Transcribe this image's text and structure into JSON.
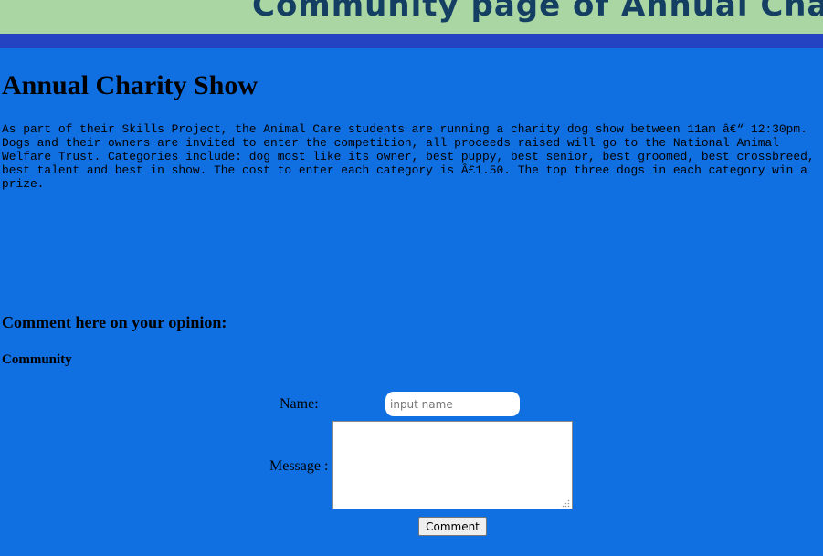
{
  "banner": {
    "title": "Community page of Annual Chari"
  },
  "page": {
    "heading": "Annual Charity Show",
    "intro": "As part of their Skills Project, the Animal Care students are running a charity dog show between 11am â€“ 12:30pm. Dogs and their owners are invited to enter the competition, all proceeds raised will go to the National Animal Welfare Trust. Categories include: dog most like its owner, best puppy, best senior, best groomed, best crossbreed, best talent and best in show. The cost to enter each category is Â£1.50. The top three dogs in each category win a prize."
  },
  "comments": {
    "heading": "Comment here on your opinion:",
    "subheading": "Community",
    "name_label": "Name:",
    "name_placeholder": "input name",
    "name_value": "",
    "message_label": "Message :",
    "message_value": "",
    "submit_label": "Comment"
  },
  "colors": {
    "page_background": "#1070e2",
    "banner_background": "#a9d6a3",
    "banner_text": "#143f63",
    "stripe": "#2443c2"
  }
}
